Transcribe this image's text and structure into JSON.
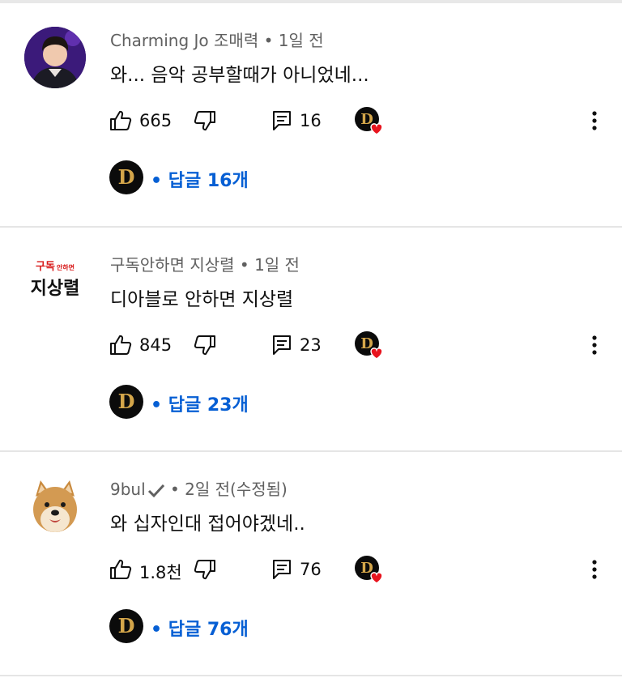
{
  "comments": [
    {
      "author": "Charming Jo 조매력",
      "time": "1일 전",
      "text": "와... 음악 공부할때가 아니었네...",
      "likes": "665",
      "replies_count": "16",
      "replies_label": "답글 16개"
    },
    {
      "author": "구독안하면 지상렬",
      "time": "1일 전",
      "text": "디아블로 안하면 지상렬",
      "likes": "845",
      "replies_count": "23",
      "replies_label": "답글 23개",
      "avatar_top": "구독",
      "avatar_top_small": "안하면",
      "avatar_bottom": "지상렬"
    },
    {
      "author": "9bul",
      "time": "2일 전(수정됨)",
      "text": "와 십자인대 접어야겠네..",
      "likes": "1.8천",
      "replies_count": "76",
      "replies_label": "답글 76개"
    }
  ],
  "separator": "•",
  "channel_logo_letter": "D",
  "colors": {
    "link_blue": "#065fd4",
    "meta_gray": "#606060",
    "heart_red": "#e8141e",
    "divider": "#e5e5e5"
  }
}
